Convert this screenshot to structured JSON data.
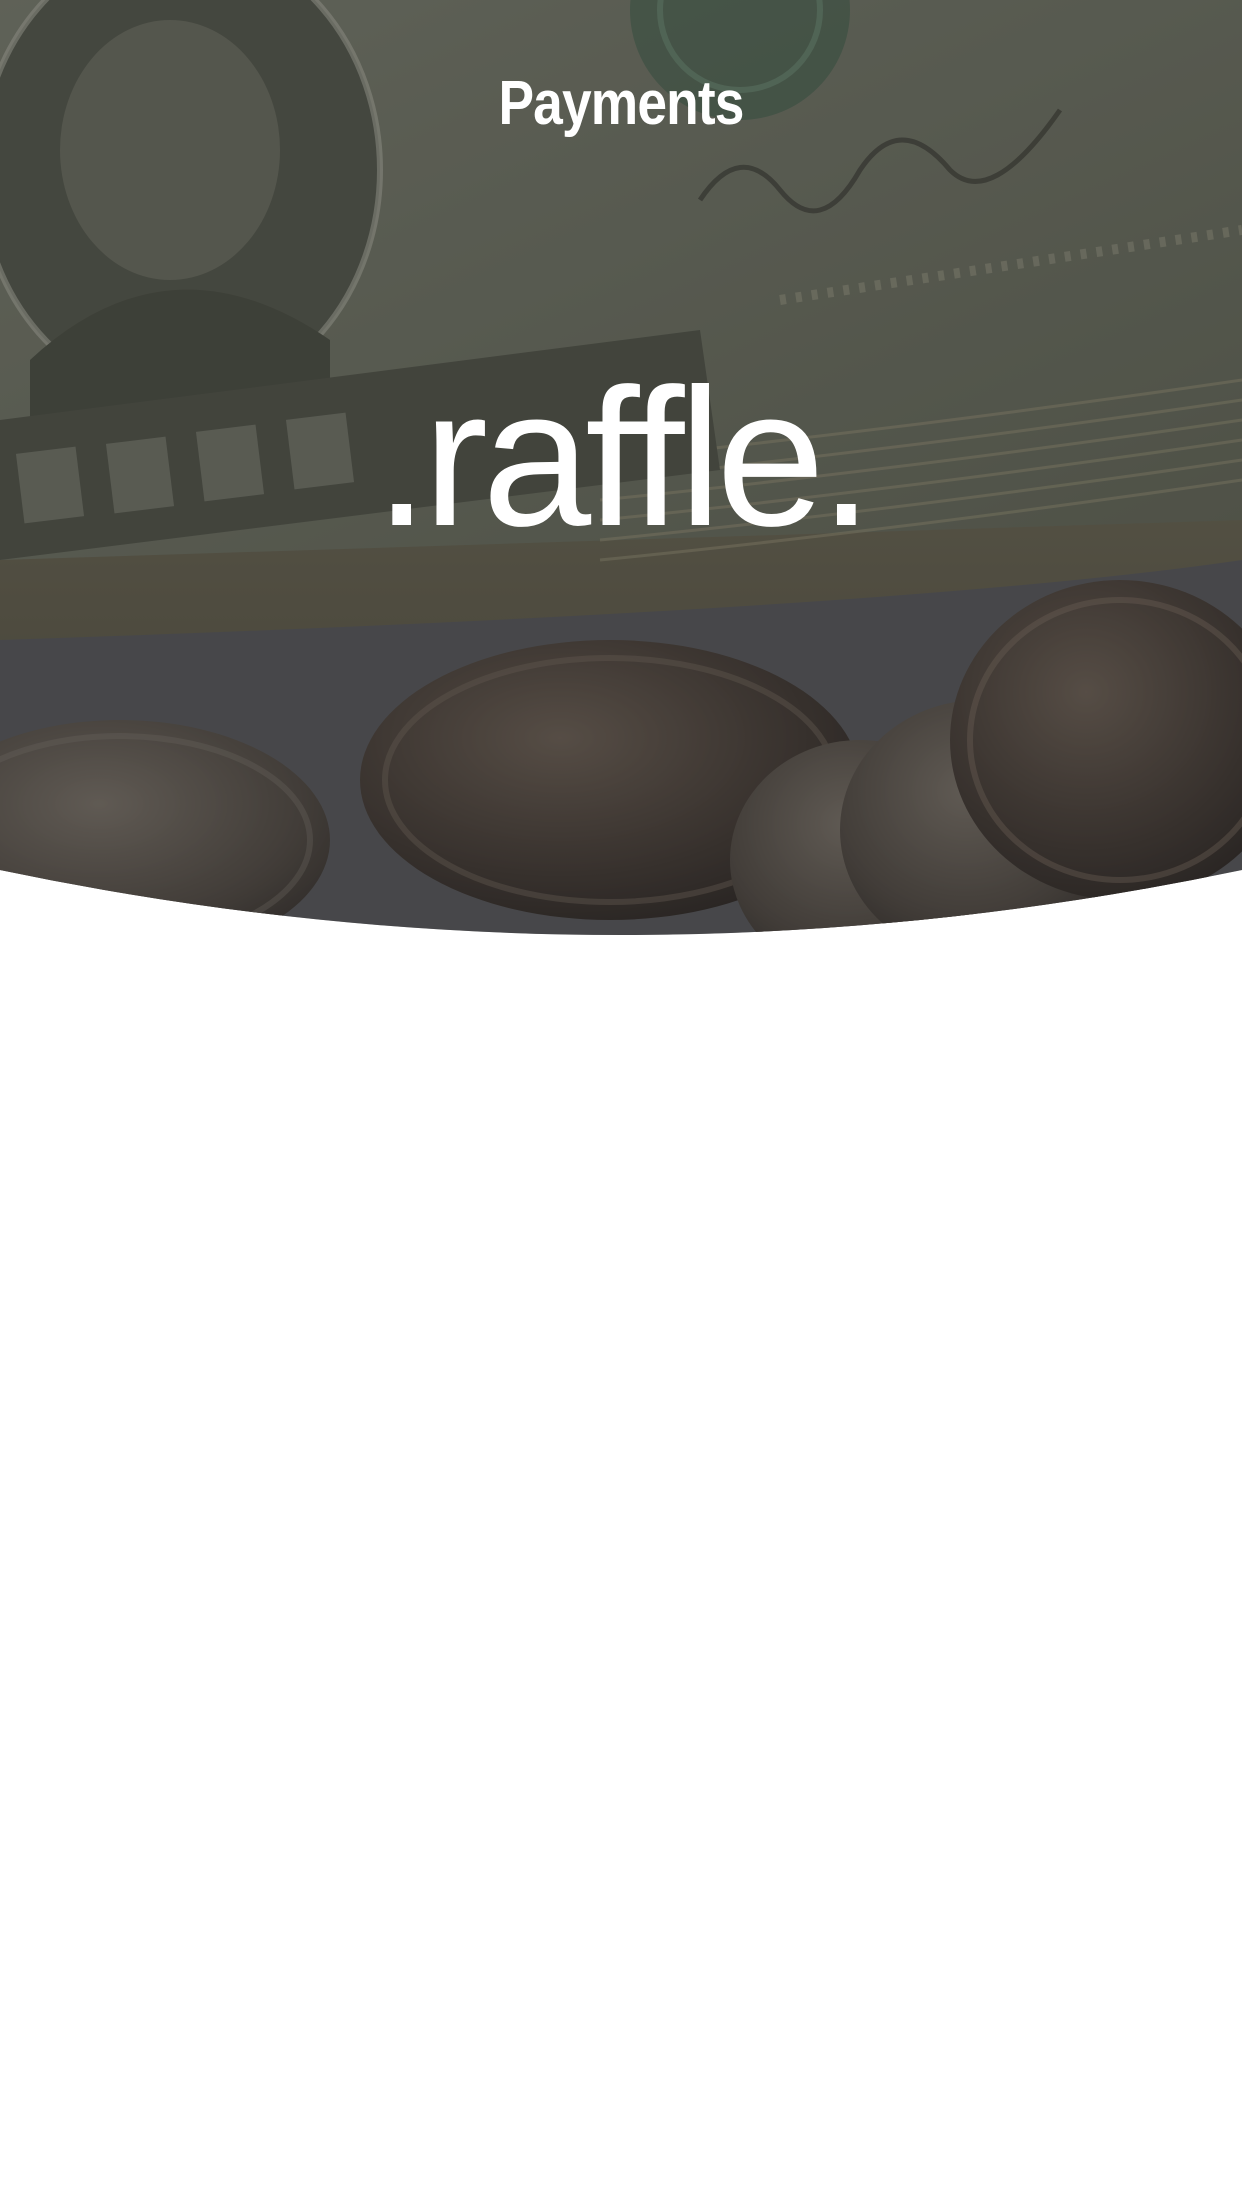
{
  "header": {
    "title": "Payments"
  },
  "hero": {
    "image": "money-background-image",
    "brand_text": ".raffle.",
    "overlay_color": "#2b2b2b"
  },
  "colors": {
    "background": "#ffffff",
    "text_on_image": "#ffffff"
  }
}
